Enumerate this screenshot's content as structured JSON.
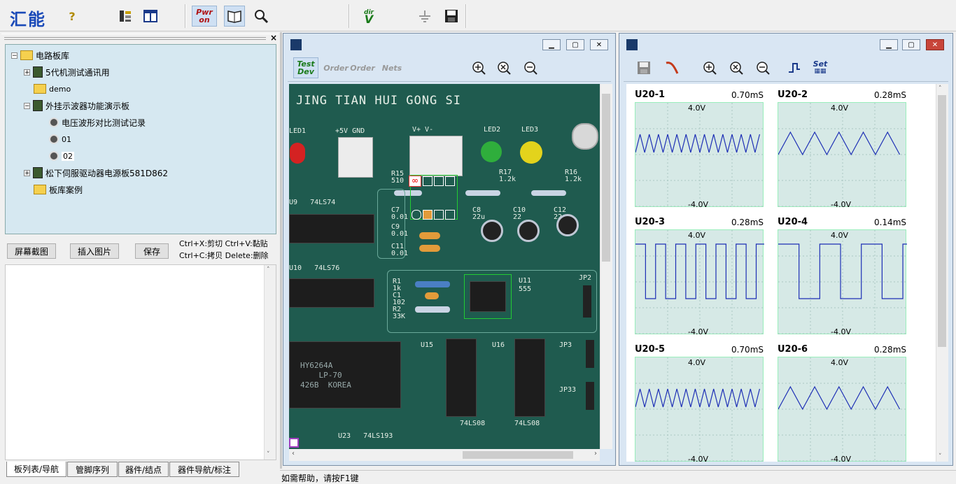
{
  "toolbar": {
    "logo": "汇能",
    "help_icon": "?",
    "pwr_on": [
      "Pwr",
      "on"
    ],
    "dir_v": [
      "dir",
      "V"
    ]
  },
  "tree": {
    "root": "电路板库",
    "items": [
      {
        "label": "5代机测试通讯用"
      },
      {
        "label": "demo"
      },
      {
        "label": "外挂示波器功能演示板"
      },
      {
        "label": "电压波形对比测试记录"
      },
      {
        "label": "01"
      },
      {
        "label": "02"
      },
      {
        "label": "松下伺服驱动器电源板581D862"
      },
      {
        "label": "板库案例"
      }
    ]
  },
  "left_buttons": {
    "screenshot": "屏幕截图",
    "insert_image": "插入图片",
    "save": "保存"
  },
  "hint": {
    "line1": "Ctrl+X:剪切 Ctrl+V:黏贴",
    "line2": "Ctrl+C:拷贝 Delete:删除"
  },
  "bottom_tabs": [
    "板列表/导航",
    "管脚序列",
    "器件/结点",
    "器件导航/标注"
  ],
  "pcb_window": {
    "tools": {
      "test_dev": [
        "Test",
        "Dev"
      ],
      "order1": "Order",
      "order2": "Order",
      "nets": "Nets"
    },
    "silk": {
      "header": "JING TIAN HUI GONG SI",
      "led1": "LED1",
      "pwr": "+5V GND",
      "vpm": "V+   V-",
      "led2": "LED2",
      "led3": "LED3",
      "r15": "R15",
      "r15v": "510",
      "r17": "R17",
      "r17v": "1.2k",
      "r16": "R16",
      "r16v": "1.2k",
      "u9": "U9",
      "u9t": "74LS74",
      "c7": "C7",
      "c7v": "0.01",
      "c9": "C9",
      "c9v": "0.01",
      "c11": "C11",
      "c11v": "0.01",
      "c8": "C8",
      "c8v": "22u",
      "c10": "C10",
      "c10v": "22",
      "c12": "C12",
      "c12v": "22",
      "u10": "U10",
      "u10t": "74LS76",
      "r1": "R1",
      "r1v": "1k",
      "c1": "C1",
      "c1v": "102",
      "r2": "R2",
      "r2v": "33K",
      "u11": "U11",
      "u11t": "555",
      "jp2": "JP2",
      "hy": "HY6264A",
      "lp": "LP-70",
      "korea": "KOREA",
      "code": "426B",
      "u15": "U15",
      "u16": "U16",
      "jp3": "JP3",
      "jp33": "JP33",
      "ls08a": "74LS08",
      "ls08b": "74LS08",
      "u23": "U23",
      "u23t": "74LS193"
    }
  },
  "scope": {
    "channels": [
      {
        "name": "U20-1",
        "time": "0.70mS",
        "vtop": "4.0V",
        "vbot": "-4.0V",
        "wave": "triangle-fast"
      },
      {
        "name": "U20-2",
        "time": "0.28mS",
        "vtop": "4.0V",
        "vbot": "-4.0V",
        "wave": "triangle-slow"
      },
      {
        "name": "U20-3",
        "time": "0.28mS",
        "vtop": "4.0V",
        "vbot": "-4.0V",
        "wave": "square-fast"
      },
      {
        "name": "U20-4",
        "time": "0.14mS",
        "vtop": "4.0V",
        "vbot": "-4.0V",
        "wave": "square-slow"
      },
      {
        "name": "U20-5",
        "time": "0.70mS",
        "vtop": "4.0V",
        "vbot": "-4.0V",
        "wave": "triangle-fast"
      },
      {
        "name": "U20-6",
        "time": "0.28mS",
        "vtop": "4.0V",
        "vbot": "-4.0V",
        "wave": "triangle-slow"
      }
    ],
    "tools": {
      "set": "Set"
    }
  },
  "status": {
    "text": "如需帮助，请按F1键"
  },
  "colors": {
    "wave": "#1d2fb5",
    "pcb": "#1f5b4f",
    "tree_bg": "#d6e8f1"
  }
}
